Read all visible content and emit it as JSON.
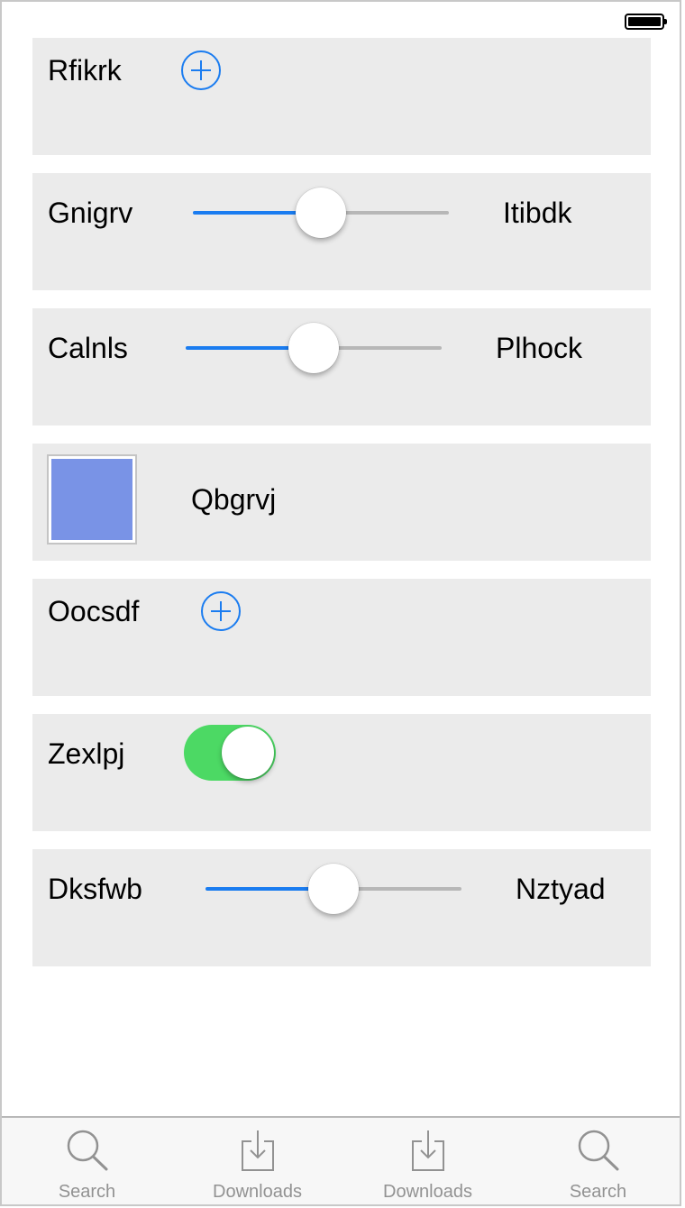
{
  "rows": {
    "r1": {
      "label": "Rfikrk"
    },
    "r2": {
      "label": "Gnigrv",
      "right_label": "Itibdk",
      "value": 0.5
    },
    "r3": {
      "label": "Calnls",
      "right_label": "Plhock",
      "value": 0.5
    },
    "r4": {
      "label": "Qbgrvj",
      "swatch_color": "#7993e6"
    },
    "r5": {
      "label": "Oocsdf"
    },
    "r6": {
      "label": "Zexlpj",
      "on": true
    },
    "r7": {
      "label": "Dksfwb",
      "right_label": "Nztyad",
      "value": 0.5
    }
  },
  "tabbar": {
    "tabs": [
      {
        "label": "Search",
        "icon": "search-icon"
      },
      {
        "label": "Downloads",
        "icon": "downloads-icon"
      },
      {
        "label": "Downloads",
        "icon": "downloads-icon"
      },
      {
        "label": "Search",
        "icon": "search-icon"
      }
    ]
  },
  "colors": {
    "accent": "#1a7cf0",
    "toggle_on": "#4cd964",
    "row_background": "#ebebeb",
    "tab_label": "#929292"
  }
}
